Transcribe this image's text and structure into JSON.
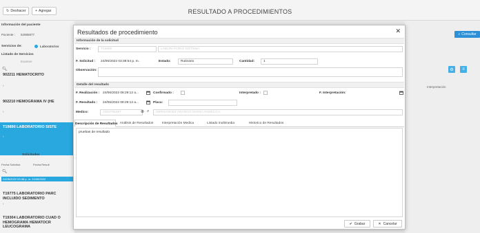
{
  "toolbar": {
    "undo_label": "Deshacer",
    "add_label": "Agregar",
    "title": "RESULTADO A PROCEDIMIENTOS"
  },
  "background": {
    "patient_section": "Información del paciente",
    "patient_label": "Paciente :",
    "patient_value": "52985877",
    "services_label": "Servicios de:",
    "services_option": "Laboratorios",
    "services_list": "Listado de Servicios",
    "exam_col": "Examen",
    "items": [
      "902211 HEMATOCRITO",
      "902210 HEMOGRAMA IV (HE",
      "T19890 LABORATORIO SISTE",
      "T19775 LABORATORIO PARC INCLUIDO SEDIMENTO",
      "T19304 LABORATORIO CUAD O HEMOGRAMA HEMATOCR LEUCOGRAMA"
    ],
    "solicitudes_label": "Solicitudes",
    "col_fecha_solicitud": "Fecha Solicitud",
    "col_fecha_result": "Fecha Result",
    "selected_row": "24/06/2022 03:38 p. m.  24/06/2022",
    "consultar_label": "Consultar",
    "interpretacion_col": "Interpretación"
  },
  "modal": {
    "title": "Resultados de procedimiento",
    "section_request": "Información de la solicitud",
    "servicio_label": "Servicio :",
    "servicio_code": "T19890",
    "servicio_name": "LABORATORIO SISTEMA",
    "fsolicitud_label": "F. Solicitud :",
    "fsolicitud_value": "24/06/2022 03:38:54 p. m.",
    "estado_label": "Estado:",
    "estado_value": "Rutinario",
    "cantidad_label": "Cantidad:",
    "cantidad_value": "1",
    "observacion_label": "Observación:",
    "section_result": "Detalle del resultado",
    "frealizacion_label": "F. Realización :",
    "frealizacion_value": "24/06/2022 08:29:12 a...",
    "confirmado_label": "Confirmado :",
    "interpretado_label": "Interpretado :",
    "finterpretacion_label": "F. Interpretación:",
    "fresultado_label": "F. Resultado :",
    "fresultado_value": "24/06/2022 08:29:12 a...",
    "placa_label": "Placa:",
    "medico_label": "Medico:",
    "medico_code": "1053765497",
    "medico_name": "HERNANDEZ ARANGO MARIA ANGELICA",
    "tabs": [
      "Descripción de Resultados",
      "Análisis de Resultados",
      "Interpretación Medica",
      "Listado multimedia",
      "Historico de Resultados"
    ],
    "result_text": "pruebas de resultado",
    "save_label": "Grabar",
    "cancel_label": "Cancelar"
  },
  "colors": {
    "accent": "#29a8e0",
    "button_blue": "#2d8fd5"
  }
}
